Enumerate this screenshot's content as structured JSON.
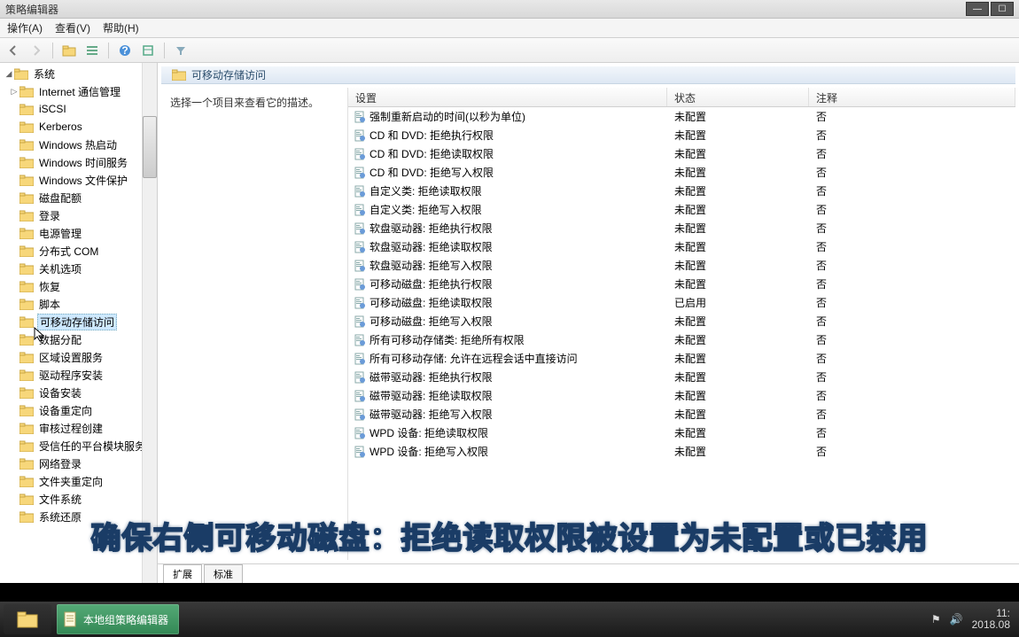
{
  "window": {
    "title": "策略编辑器"
  },
  "menu": {
    "action": "操作(A)",
    "view": "查看(V)",
    "help": "帮助(H)"
  },
  "tree": {
    "root": "系统",
    "items": [
      "Internet 通信管理",
      "iSCSI",
      "Kerberos",
      "Windows 热启动",
      "Windows 时间服务",
      "Windows 文件保护",
      "磁盘配额",
      "登录",
      "电源管理",
      "分布式 COM",
      "关机选项",
      "恢复",
      "脚本",
      "可移动存储访问",
      "数据分配",
      "区域设置服务",
      "驱动程序安装",
      "设备安装",
      "设备重定向",
      "审核过程创建",
      "受信任的平台模块服务",
      "网络登录",
      "文件夹重定向",
      "文件系统",
      "系统还原"
    ],
    "selectedIndex": 13
  },
  "pane": {
    "title": "可移动存储访问",
    "desc": "选择一个项目来查看它的描述。",
    "cols": {
      "setting": "设置",
      "state": "状态",
      "comment": "注释"
    },
    "rows": [
      {
        "s": "强制重新启动的时间(以秒为单位)",
        "st": "未配置",
        "c": "否"
      },
      {
        "s": "CD 和 DVD: 拒绝执行权限",
        "st": "未配置",
        "c": "否"
      },
      {
        "s": "CD 和 DVD: 拒绝读取权限",
        "st": "未配置",
        "c": "否"
      },
      {
        "s": "CD 和 DVD: 拒绝写入权限",
        "st": "未配置",
        "c": "否"
      },
      {
        "s": "自定义类: 拒绝读取权限",
        "st": "未配置",
        "c": "否"
      },
      {
        "s": "自定义类: 拒绝写入权限",
        "st": "未配置",
        "c": "否"
      },
      {
        "s": "软盘驱动器: 拒绝执行权限",
        "st": "未配置",
        "c": "否"
      },
      {
        "s": "软盘驱动器: 拒绝读取权限",
        "st": "未配置",
        "c": "否"
      },
      {
        "s": "软盘驱动器: 拒绝写入权限",
        "st": "未配置",
        "c": "否"
      },
      {
        "s": "可移动磁盘: 拒绝执行权限",
        "st": "未配置",
        "c": "否"
      },
      {
        "s": "可移动磁盘: 拒绝读取权限",
        "st": "已启用",
        "c": "否"
      },
      {
        "s": "可移动磁盘: 拒绝写入权限",
        "st": "未配置",
        "c": "否"
      },
      {
        "s": "所有可移动存储类: 拒绝所有权限",
        "st": "未配置",
        "c": "否"
      },
      {
        "s": "所有可移动存储: 允许在远程会话中直接访问",
        "st": "未配置",
        "c": "否"
      },
      {
        "s": "磁带驱动器: 拒绝执行权限",
        "st": "未配置",
        "c": "否"
      },
      {
        "s": "磁带驱动器: 拒绝读取权限",
        "st": "未配置",
        "c": "否"
      },
      {
        "s": "磁带驱动器: 拒绝写入权限",
        "st": "未配置",
        "c": "否"
      },
      {
        "s": "WPD 设备: 拒绝读取权限",
        "st": "未配置",
        "c": "否"
      },
      {
        "s": "WPD 设备: 拒绝写入权限",
        "st": "未配置",
        "c": "否"
      }
    ],
    "tabs": {
      "extended": "扩展",
      "standard": "标准"
    }
  },
  "caption": "确保右侧可移动磁盘：拒绝读取权限被设置为未配置或已禁用",
  "taskbar": {
    "app": "本地组策略编辑器",
    "time": "11:",
    "date": "2018.08"
  }
}
